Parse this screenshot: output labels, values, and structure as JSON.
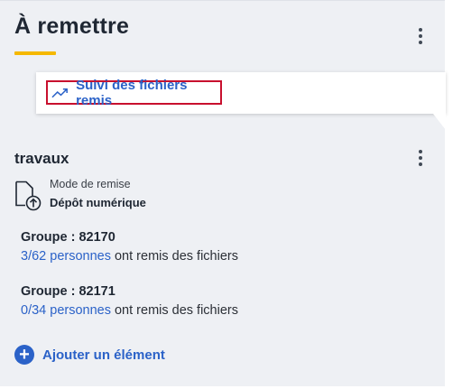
{
  "header": {
    "title": "À remettre",
    "menu_icon": "vertical-dots-icon"
  },
  "dropdown": {
    "item_label": "Suivi des fichiers remis",
    "item_icon": "trending-up-icon"
  },
  "section": {
    "title": "travaux",
    "menu_icon": "vertical-dots-icon",
    "mode_label": "Mode de remise",
    "mode_value": "Dépôt numérique",
    "mode_icon": "file-upload-icon"
  },
  "groups": [
    {
      "title": "Groupe : 82170",
      "link": "3/62 personnes",
      "suffix": " ont remis des fichiers"
    },
    {
      "title": "Groupe : 82171",
      "link": "0/34 personnes",
      "suffix": " ont remis des fichiers"
    }
  ],
  "add_button": {
    "label": "Ajouter un élément",
    "icon": "plus-circle-icon"
  },
  "colors": {
    "accent": "#2b62c8",
    "underline": "#f5b800",
    "focus": "#c8102e",
    "panel": "#eef0f4"
  }
}
